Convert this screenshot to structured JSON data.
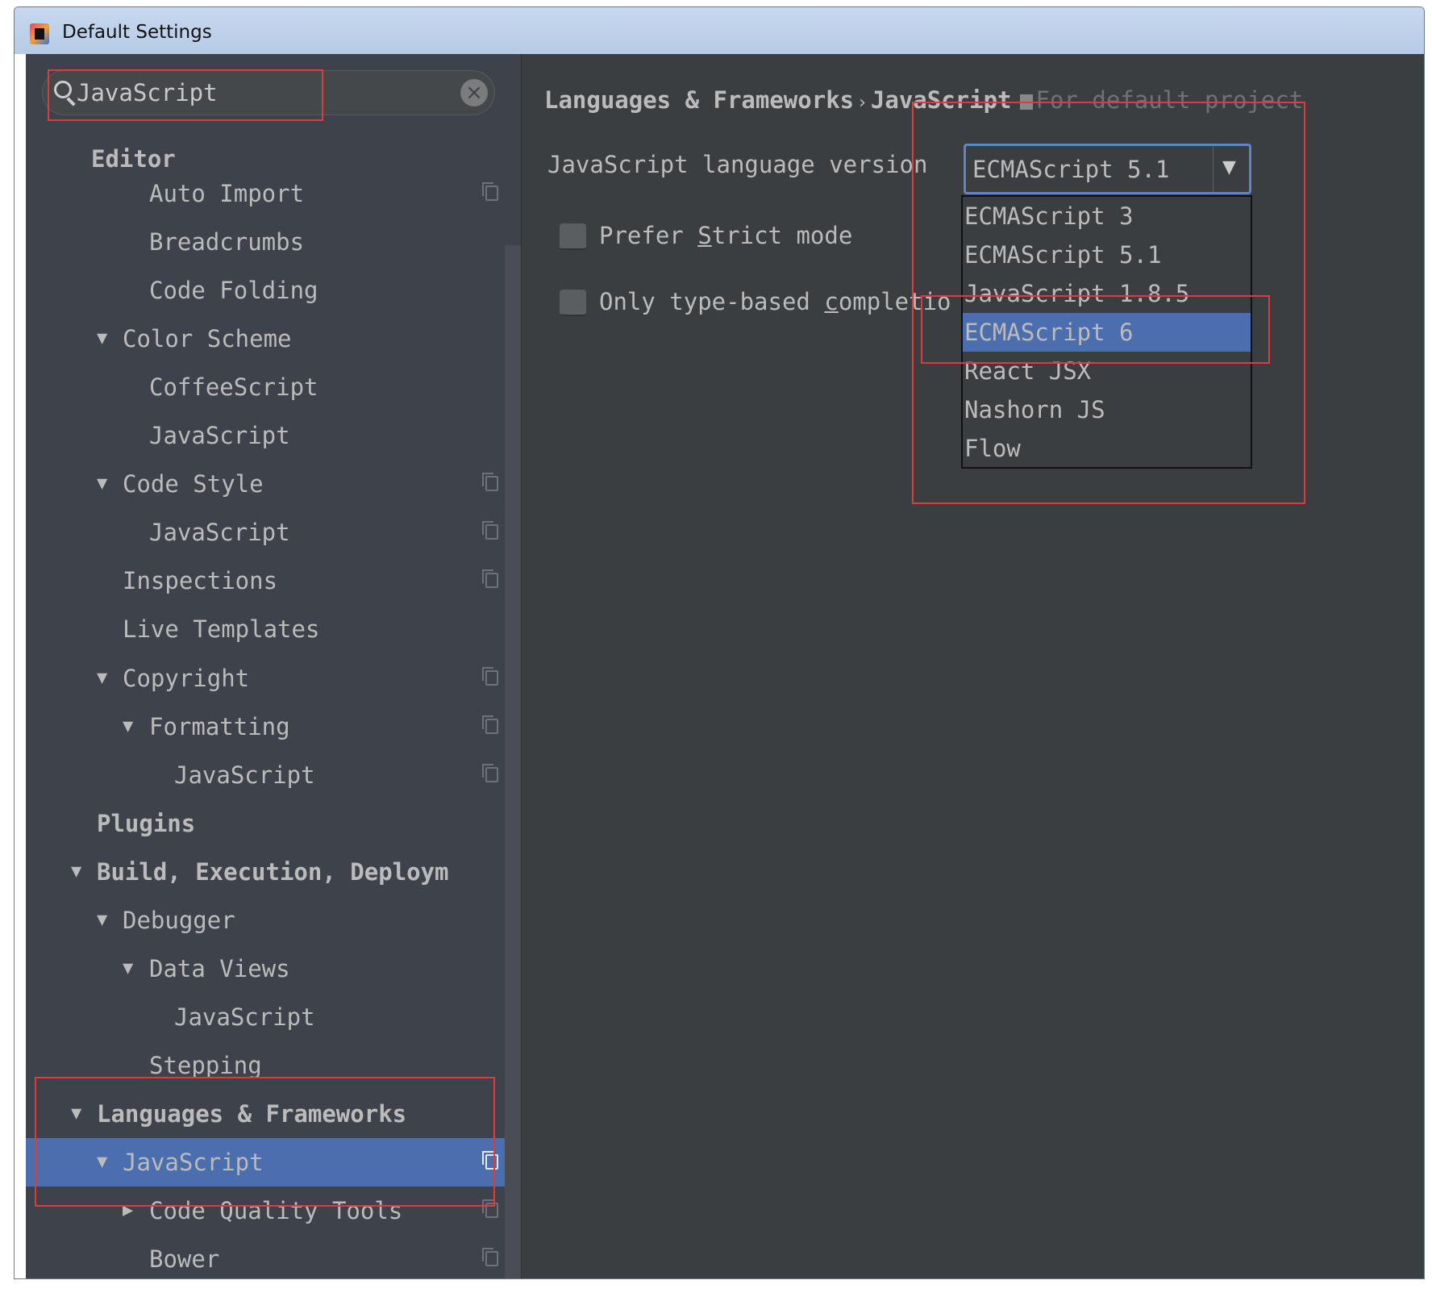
{
  "window": {
    "title": "Default Settings"
  },
  "search": {
    "value": "JavaScript",
    "clear_icon": "close-circle-icon"
  },
  "tree": [
    {
      "label": "Editor",
      "level": 0,
      "bold": true
    },
    {
      "label": "Auto Import",
      "level": 3,
      "copy": true
    },
    {
      "label": "Breadcrumbs",
      "level": 3
    },
    {
      "label": "Code Folding",
      "level": 3
    },
    {
      "label": "Color Scheme",
      "level": 2,
      "expanded": true
    },
    {
      "label": "CoffeeScript",
      "level": 3
    },
    {
      "label": "JavaScript",
      "level": 3
    },
    {
      "label": "Code Style",
      "level": 2,
      "expanded": true,
      "copy": true
    },
    {
      "label": "JavaScript",
      "level": 3,
      "copy": true
    },
    {
      "label": "Inspections",
      "level": 2,
      "copy": true
    },
    {
      "label": "Live Templates",
      "level": 2
    },
    {
      "label": "Copyright",
      "level": 2,
      "expanded": true,
      "copy": true
    },
    {
      "label": "Formatting",
      "level": 3,
      "expanded": true,
      "copy": true
    },
    {
      "label": "JavaScript",
      "level": 4,
      "copy": true
    },
    {
      "label": "Plugins",
      "level": 1,
      "bold": true
    },
    {
      "label": "Build, Execution, Deploym",
      "level": 1,
      "bold": true,
      "expanded": true
    },
    {
      "label": "Debugger",
      "level": 2,
      "expanded": true
    },
    {
      "label": "Data Views",
      "level": 3,
      "expanded": true
    },
    {
      "label": "JavaScript",
      "level": 4
    },
    {
      "label": "Stepping",
      "level": 3
    },
    {
      "label": "Languages & Frameworks",
      "level": 1,
      "bold": true,
      "expanded": true
    },
    {
      "label": "JavaScript",
      "level": 2,
      "expanded": true,
      "copy": true,
      "selected": true
    },
    {
      "label": "Code Quality Tools",
      "level": 3,
      "collapsed": true,
      "copy": true
    },
    {
      "label": "Bower",
      "level": 3,
      "copy": true
    }
  ],
  "breadcrumb": {
    "parent": "Languages & Frameworks",
    "separator": "›",
    "current": "JavaScript",
    "hint": "For default project"
  },
  "settings": {
    "language_version_label": "JavaScript language version",
    "language_version_value": "ECMAScript 5.1",
    "options": [
      "ECMAScript 3",
      "ECMAScript 5.1",
      "JavaScript 1.8.5",
      "ECMAScript 6",
      "React JSX",
      "Nashorn JS",
      "Flow"
    ],
    "highlighted_option": "ECMAScript 6",
    "prefer_strict": {
      "pre": "Prefer ",
      "mnemonic": "S",
      "post": "trict mode",
      "checked": false
    },
    "type_completion": {
      "pre": "Only type-based ",
      "mnemonic": "c",
      "post": "ompletio",
      "checked": false
    }
  },
  "colors": {
    "selection": "#4b6eaf",
    "annotation": "#e03a3a",
    "sidebar": "#3e434b",
    "panel": "#3b3e41"
  }
}
